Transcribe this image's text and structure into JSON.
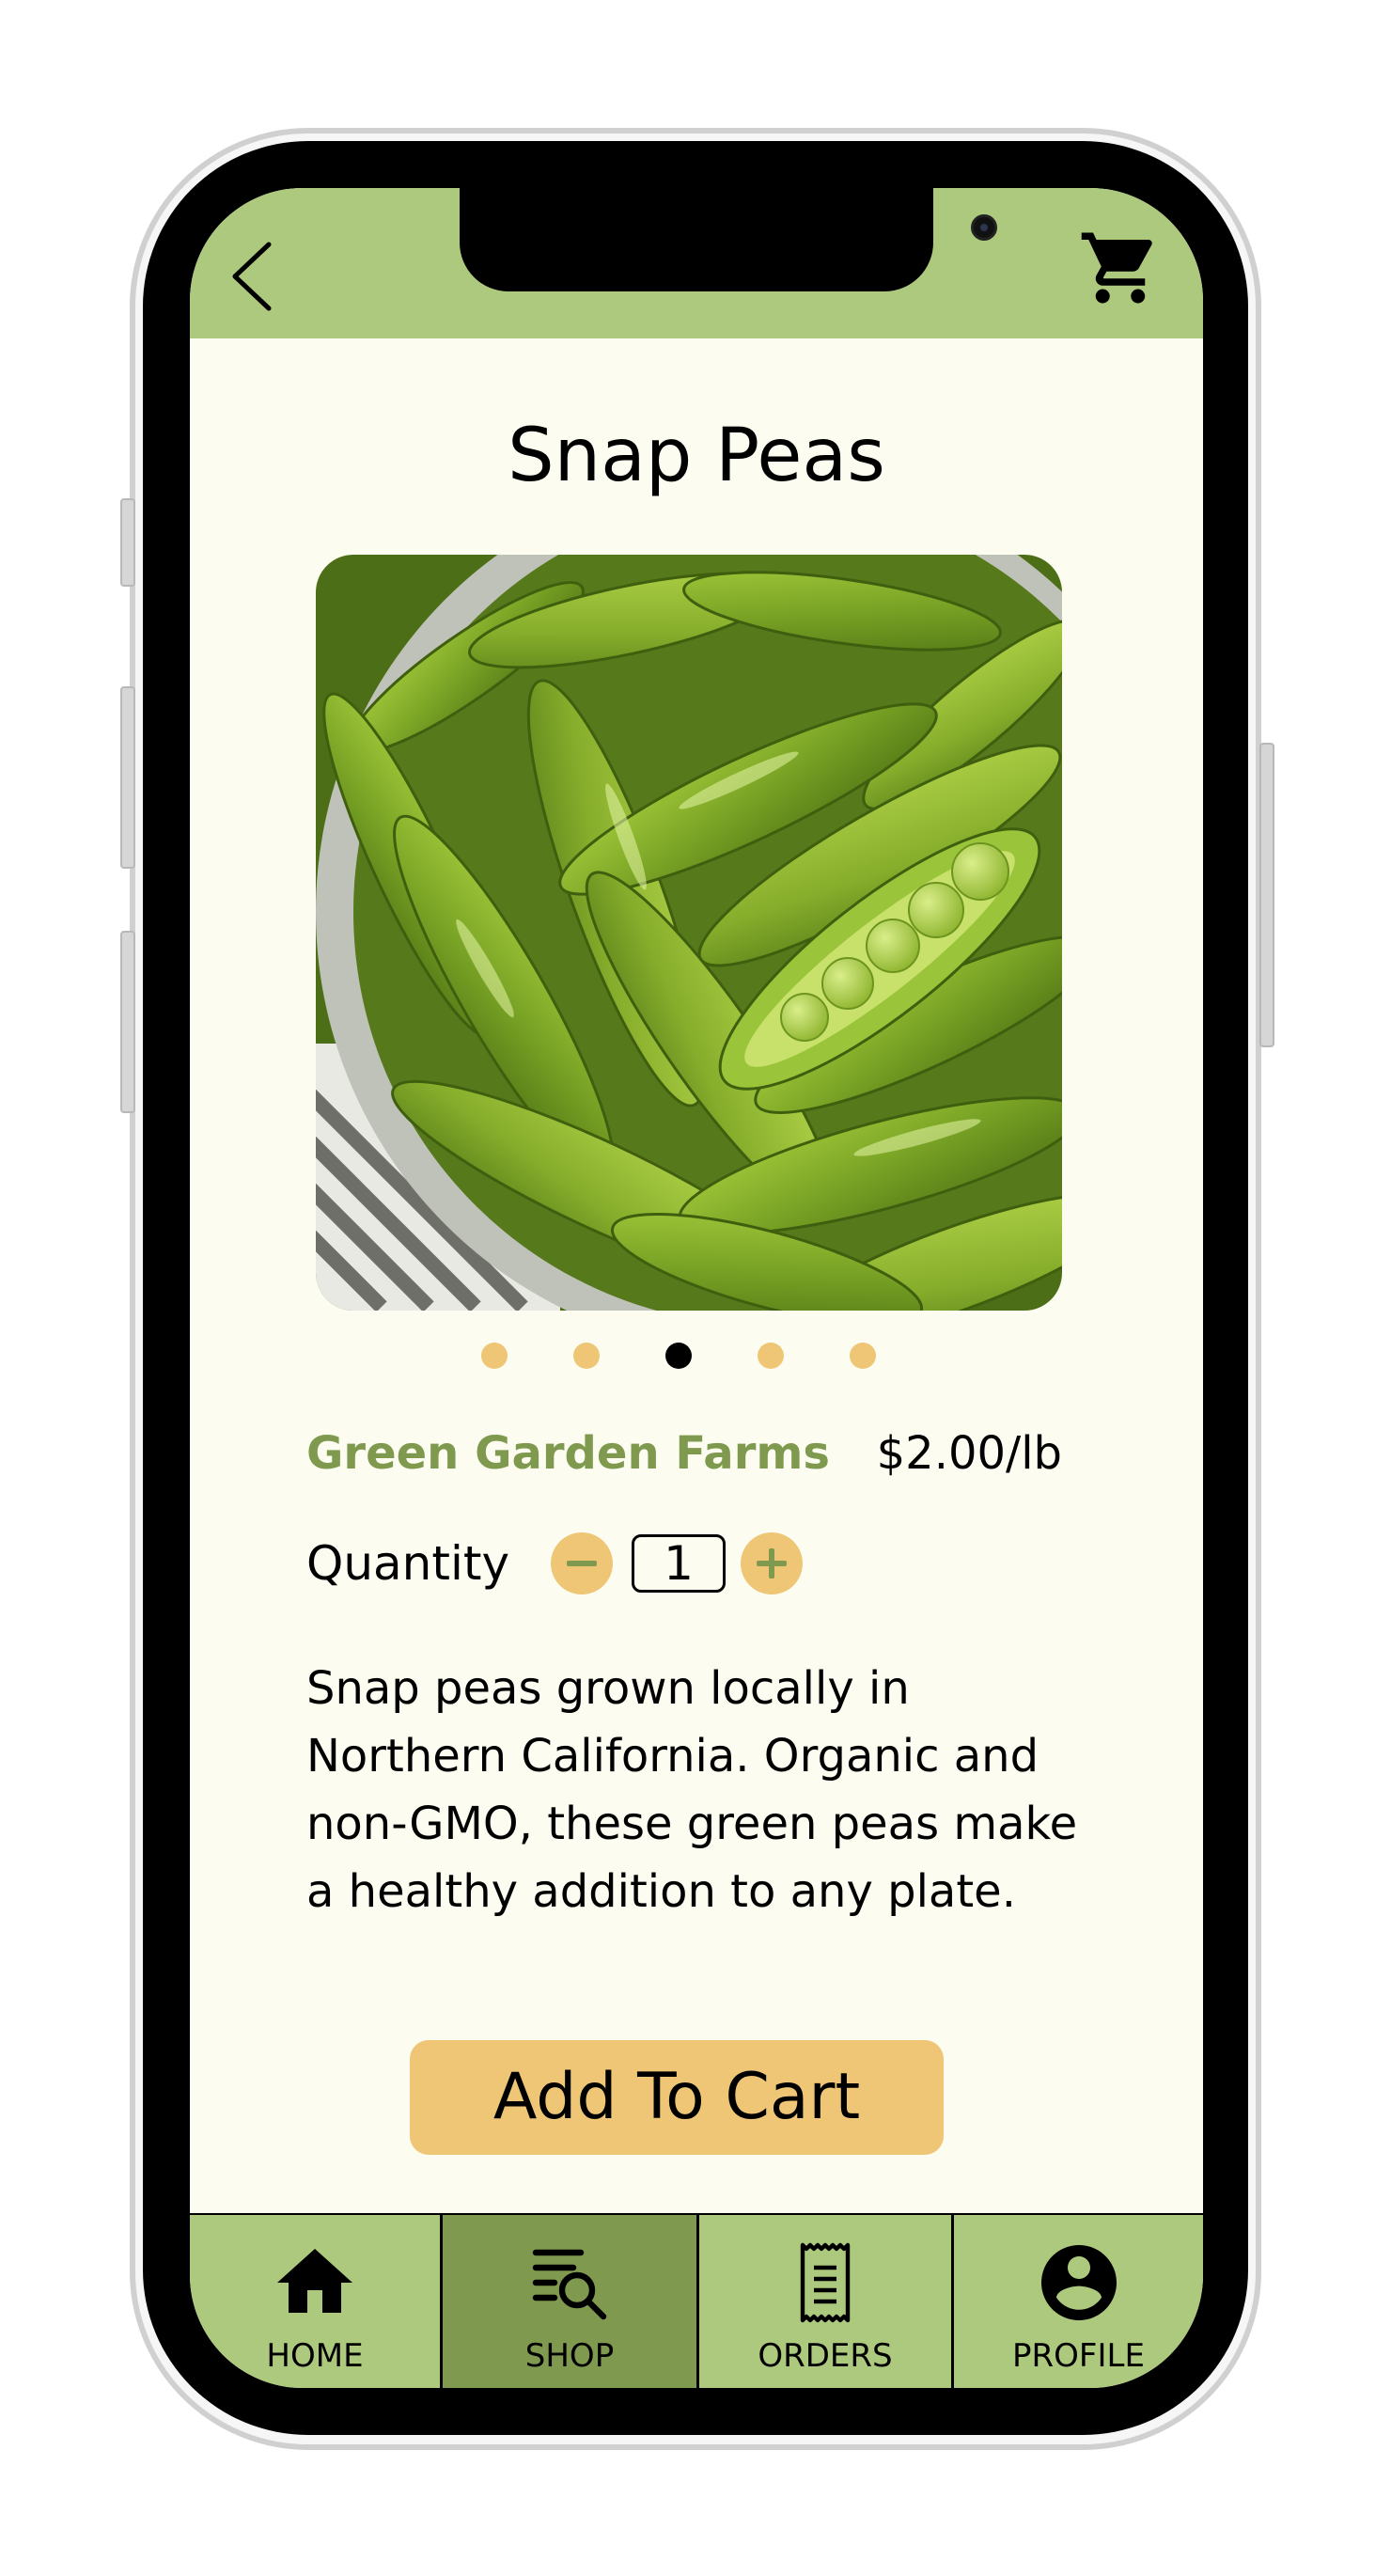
{
  "header": {
    "back_icon": "chevron-left-icon",
    "cart_icon": "shopping-cart-icon"
  },
  "product": {
    "title": "Snap Peas",
    "image": "snap-peas-photo",
    "carousel_count": 5,
    "carousel_active": 3,
    "farm": "Green Garden Farms",
    "price": "$2.00/lb",
    "quantity_label": "Quantity",
    "quantity_value": "1",
    "description": "Snap peas grown locally in Northern California. Organic and non-GMO, these green peas make a healthy addition to any plate.",
    "add_button": "Add To Cart"
  },
  "nav": {
    "items": [
      {
        "label": "HOME",
        "icon": "home-icon",
        "active": false
      },
      {
        "label": "SHOP",
        "icon": "shop-search-icon",
        "active": true
      },
      {
        "label": "ORDERS",
        "icon": "receipt-icon",
        "active": false
      },
      {
        "label": "PROFILE",
        "icon": "profile-icon",
        "active": false
      }
    ]
  },
  "colors": {
    "accent_green": "#adc97d",
    "dark_green": "#7f9a4f",
    "gold": "#efc676",
    "background": "#fcfdf0"
  }
}
